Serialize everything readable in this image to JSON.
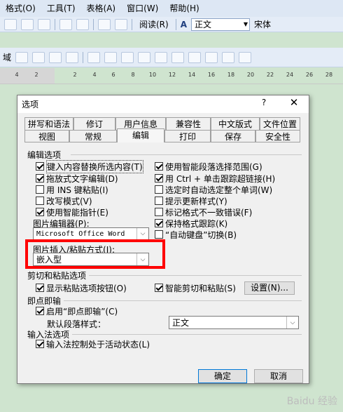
{
  "menubar": {
    "items": [
      "格式(O)",
      "工具(T)",
      "表格(A)",
      "窗口(W)",
      "帮助(H)"
    ]
  },
  "toolbar": {
    "read_label": "阅读(R)",
    "style_value": "正文",
    "font_value": "宋体",
    "font_prefix": "域"
  },
  "ruler": {
    "ticks": [
      "4",
      "2",
      "2",
      "4",
      "6",
      "8",
      "10",
      "12",
      "14",
      "16",
      "18",
      "20",
      "22",
      "24",
      "26",
      "28"
    ]
  },
  "dialog": {
    "title": "选项",
    "help": "?",
    "close": "✕",
    "tabs_back": [
      "拼写和语法",
      "修订",
      "用户信息",
      "兼容性",
      "中文版式",
      "文件位置"
    ],
    "tabs_front": [
      "视图",
      "常规",
      "编辑",
      "打印",
      "保存",
      "安全性"
    ],
    "selected_tab": "编辑",
    "edit_group": {
      "label": "编辑选项",
      "left": [
        {
          "label": "键入内容替换所选内容(T)",
          "checked": true
        },
        {
          "label": "拖放式文字编辑(D)",
          "checked": true
        },
        {
          "label": "用 INS 键粘贴(I)",
          "checked": false
        },
        {
          "label": "改写模式(V)",
          "checked": false
        },
        {
          "label": "使用智能指针(E)",
          "checked": true
        }
      ],
      "right": [
        {
          "label": "使用智能段落选择范围(G)",
          "checked": true
        },
        {
          "label": "用 Ctrl + 单击跟踪超链接(H)",
          "checked": true
        },
        {
          "label": "选定时自动选定整个单词(W)",
          "checked": false
        },
        {
          "label": "提示更新样式(Y)",
          "checked": false
        },
        {
          "label": "标记格式不一致错误(F)",
          "checked": false
        },
        {
          "label": "保持格式跟踪(K)",
          "checked": true
        },
        {
          "label": "“自动键盘”切换(B)",
          "checked": false
        }
      ],
      "picture_editor_label": "图片编辑器(P):",
      "picture_editor_value": "Microsoft Office Word",
      "insert_paste_label": "图片插入/粘贴方式(I):",
      "insert_paste_value": "嵌入型"
    },
    "cut_paste_group": {
      "label": "剪切和粘贴选项",
      "show_paste_buttons": {
        "label": "显示粘贴选项按钮(O)",
        "checked": true
      },
      "smart_cut_paste": {
        "label": "智能剪切和粘贴(S)",
        "checked": true
      },
      "settings_button": "设置(N)..."
    },
    "click_type_group": {
      "label": "即点即输",
      "enable": {
        "label": "启用“即点即输”(C)",
        "checked": true
      },
      "default_style_label": "默认段落样式：",
      "default_style_value": "正文"
    },
    "ime_group": {
      "label": "输入法选项",
      "ime_control": {
        "label": "输入法控制处于活动状态(L)",
        "checked": true
      }
    },
    "ok": "确定",
    "cancel": "取消"
  },
  "watermark": "Baidu 经验"
}
